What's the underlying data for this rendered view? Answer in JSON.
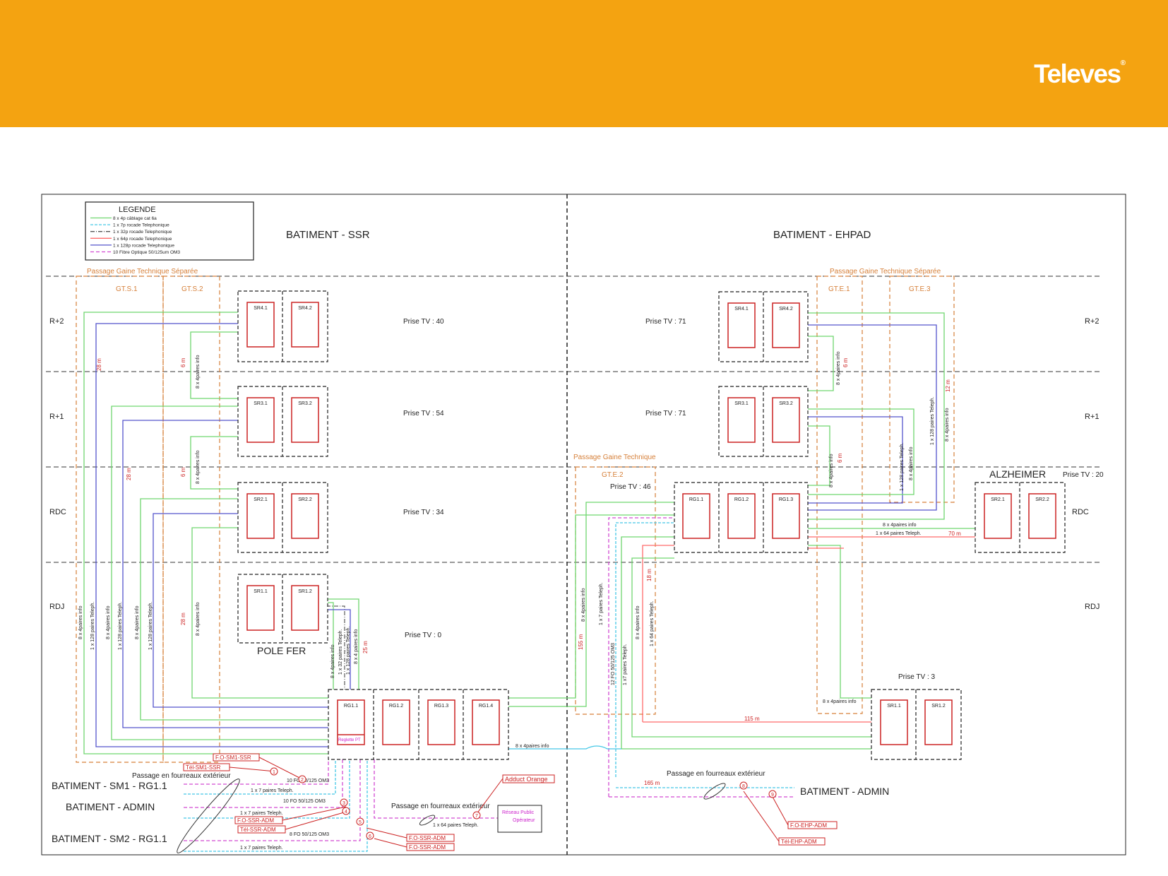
{
  "header": {
    "brand": "Televes",
    "brand_color": "#f4a311"
  },
  "legend": {
    "title": "LEGENDE",
    "items": [
      {
        "label": "8 x 4p câblage cat 6a",
        "color": "#6fd66f",
        "dash": ""
      },
      {
        "label": "1 x 7p rocade Telephonique",
        "color": "#46c8e6",
        "dash": "4 2"
      },
      {
        "label": "1 x 32p rocade Telephonique",
        "color": "#555555",
        "dash": "6 2 1 2"
      },
      {
        "label": "1 x 64p rocade Telephonique",
        "color": "#ff6b6b",
        "dash": ""
      },
      {
        "label": "1 x 128p rocade Telephonique",
        "color": "#5555cc",
        "dash": ""
      },
      {
        "label": "10 Fibre Optique 50/125um OM3",
        "color": "#d24ad2",
        "dash": "5 3"
      }
    ]
  },
  "buildings": {
    "ssr": "BATIMENT - SSR",
    "ehpad": "BATIMENT - EHPAD"
  },
  "gaines": {
    "ssr_sep": "Passage Gaine Technique Séparée",
    "ehpad_sep": "Passage Gaine Technique Séparée",
    "ehpad_gaine": "Passage Gaine Technique",
    "gts1": "GT.S.1",
    "gts2": "GT.S.2",
    "gte1": "GT.E.1",
    "gte2": "GT.E.2",
    "gte3": "GT.E.3"
  },
  "floors": {
    "r2": "R+2",
    "r1": "R+1",
    "rdc": "RDC",
    "rdj": "RDJ"
  },
  "ssr": {
    "r2": {
      "tv": "Prise TV : 40",
      "a": "SR4.1",
      "b": "SR4.2"
    },
    "r1": {
      "tv": "Prise TV : 54",
      "a": "SR3.1",
      "b": "SR3.2"
    },
    "rdc": {
      "tv": "Prise TV : 34",
      "a": "SR2.1",
      "b": "SR2.2"
    },
    "rdj": {
      "tv": "Prise TV : 0",
      "a": "SR1.1",
      "b": "SR1.2"
    },
    "polefer": "POLE FER",
    "rg": [
      "RG1.1",
      "RG1.2",
      "RG1.3",
      "RG1.4"
    ],
    "reglette": "Reglette PT"
  },
  "ehpad": {
    "r2": {
      "tv": "Prise TV : 71",
      "a": "SR4.1",
      "b": "SR4.2"
    },
    "r1": {
      "tv": "Prise TV : 71",
      "a": "SR3.1",
      "b": "SR3.2"
    },
    "rdc": {
      "tv": "Prise TV : 46",
      "rg": [
        "RG1.1",
        "RG1.2",
        "RG1.3"
      ]
    },
    "alz": {
      "title": "ALZHEIMER",
      "tv": "Prise TV : 20",
      "a": "SR2.1",
      "b": "SR2.2"
    },
    "rdj": {
      "tv": "Prise TV : 3",
      "a": "SR1.1",
      "b": "SR1.2"
    }
  },
  "cables": {
    "ssr_left": [
      "8 x 4paires info",
      "1 x 128 paires Teleph.",
      "8 x 4paires info",
      "1 x 128 paires Teleph.",
      "8 x 4paires info",
      "1 x 128 paires Teleph."
    ],
    "ssr_r2": "8 x 4paires info",
    "ssr_r1": "8 x 4paires info",
    "ssr_rdj": "8 x 4paires info",
    "polefer": [
      "8 x 4paires info",
      "1 x 32 paires Teleph.",
      "1 x 128 paires Teleph.",
      "8 x 4 paires info"
    ],
    "rg_link": "8 x 4paires info",
    "ehpad_r2": "8 x 4paires info",
    "ehpad_r1": "8 x 4paires info",
    "ehpad_tel1": "1 x 128 paires Teleph.",
    "ehpad_tel2": "1 x 128 paires Teleph.",
    "ehpad_info3": "8 x 4paires info",
    "ehpad_info4": "8 x 4paires info",
    "alz_info": "8 x 4paires info",
    "alz_tel": "1 x 64 paires Teleph.",
    "gte2": [
      "8 x 4paires info",
      "1 x 7 paires Teleph.",
      "12 FO 50/125 OM3",
      "1 x7 paires Teleph.",
      "8 x 4paires info",
      "1 x 64 paires Teleph."
    ],
    "ehpad_rdj_info": "8 x 4paires info"
  },
  "distances": {
    "ssr_a": "28 m",
    "ssr_b": "28 m",
    "ssr_c": "28 m",
    "ssr_r2": "6 m",
    "ssr_r1": "6 m",
    "polefer": "25 m",
    "ehpad_r2": "6 m",
    "ehpad_r1": "6 m",
    "ehpad_r2b": "12 m",
    "alz": "70 m",
    "gte2_a": "155 m",
    "gte2_b": "18 m",
    "rdj": "115 m",
    "admin": "165 m"
  },
  "outside": {
    "duct_ssr": "Passage en fourreaux extérieur",
    "duct_pub": "Passage en fourreaux extérieur",
    "duct_ehpad": "Passage en fourreaux extérieur",
    "bat_sm1": "BATIMENT - SM1 - RG1.1",
    "bat_admin": "BATIMENT - ADMIN",
    "bat_sm2": "BATIMENT - SM2 - RG1.1",
    "bat_admin_e": "BATIMENT - ADMIN",
    "sm1_fo": "10 FO 50/125 OM3",
    "sm1_tel": "1 x 7 paires Teleph.",
    "admin_fo": "10 FO 50/125 OM3",
    "admin_tel": "1 x 7 paires Teleph.",
    "sm2_fo": "8 FO 50/125 OM3",
    "sm2_tel": "1 x 7 paires Teleph.",
    "pub_tel": "1 x 64 paires Teleph.",
    "adduct": "Adduct Orange",
    "reseau": "Réseau Public",
    "operateur": "Opérateur",
    "tags": [
      "F.O-SM1-SSR",
      "Tél-SM1-SSR",
      "F.O-SSR-ADM",
      "Tél-SSR-ADM",
      "F.O-SSR-ADM",
      "F.O-SSR-ADM",
      "F.O-EHP-ADM",
      "Tél-EHP-ADM"
    ],
    "nums": [
      "1",
      "2",
      "3",
      "4",
      "5",
      "6",
      "7",
      "8",
      "9"
    ]
  }
}
